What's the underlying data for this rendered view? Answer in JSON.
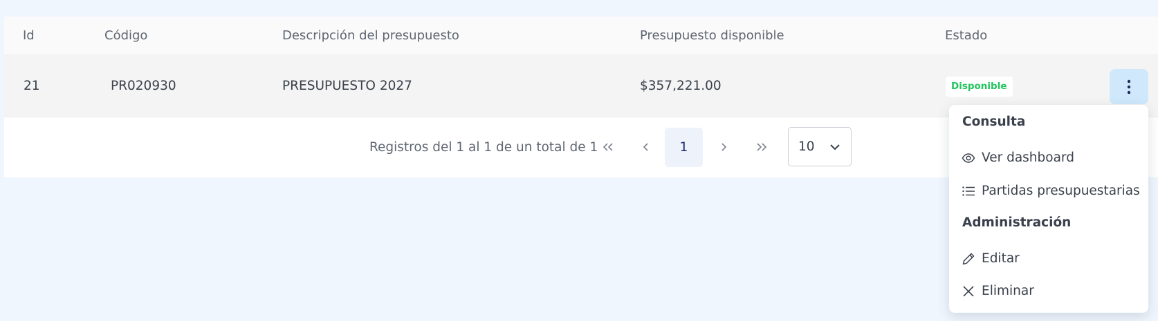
{
  "table": {
    "columns": {
      "id": "Id",
      "code": "Código",
      "description": "Descripción del presupuesto",
      "available": "Presupuesto disponible",
      "status": "Estado"
    },
    "rows": [
      {
        "id": "21",
        "code": "PR020930",
        "description": "PRESUPUESTO 2027",
        "available": "$357,221.00",
        "status": "Disponible",
        "status_color": "#22c55e",
        "actions_icon": "kebab-vertical-icon"
      }
    ]
  },
  "pagination": {
    "info": "Registros del 1 al 1 de un total de 1",
    "current_page": "1",
    "page_size": "10",
    "icons": {
      "first": "double-chevron-left-icon",
      "prev": "chevron-left-icon",
      "next": "chevron-right-icon",
      "last": "double-chevron-right-icon",
      "select": "chevron-down-icon"
    }
  },
  "actions_menu": {
    "sections": [
      {
        "title": "Consulta",
        "items": [
          {
            "label": "Ver dashboard",
            "icon": "eye-icon"
          },
          {
            "label": "Partidas presupuestarias",
            "icon": "list-icon"
          }
        ]
      },
      {
        "title": "Administración",
        "items": [
          {
            "label": "Editar",
            "icon": "pencil-icon"
          },
          {
            "label": "Eliminar",
            "icon": "close-icon"
          }
        ]
      }
    ]
  },
  "colors": {
    "page_background": "#f0f6fe",
    "status_available": "#22c55e",
    "active_page_background": "#eef2fb",
    "kebab_button_background": "#cfe8fb"
  }
}
